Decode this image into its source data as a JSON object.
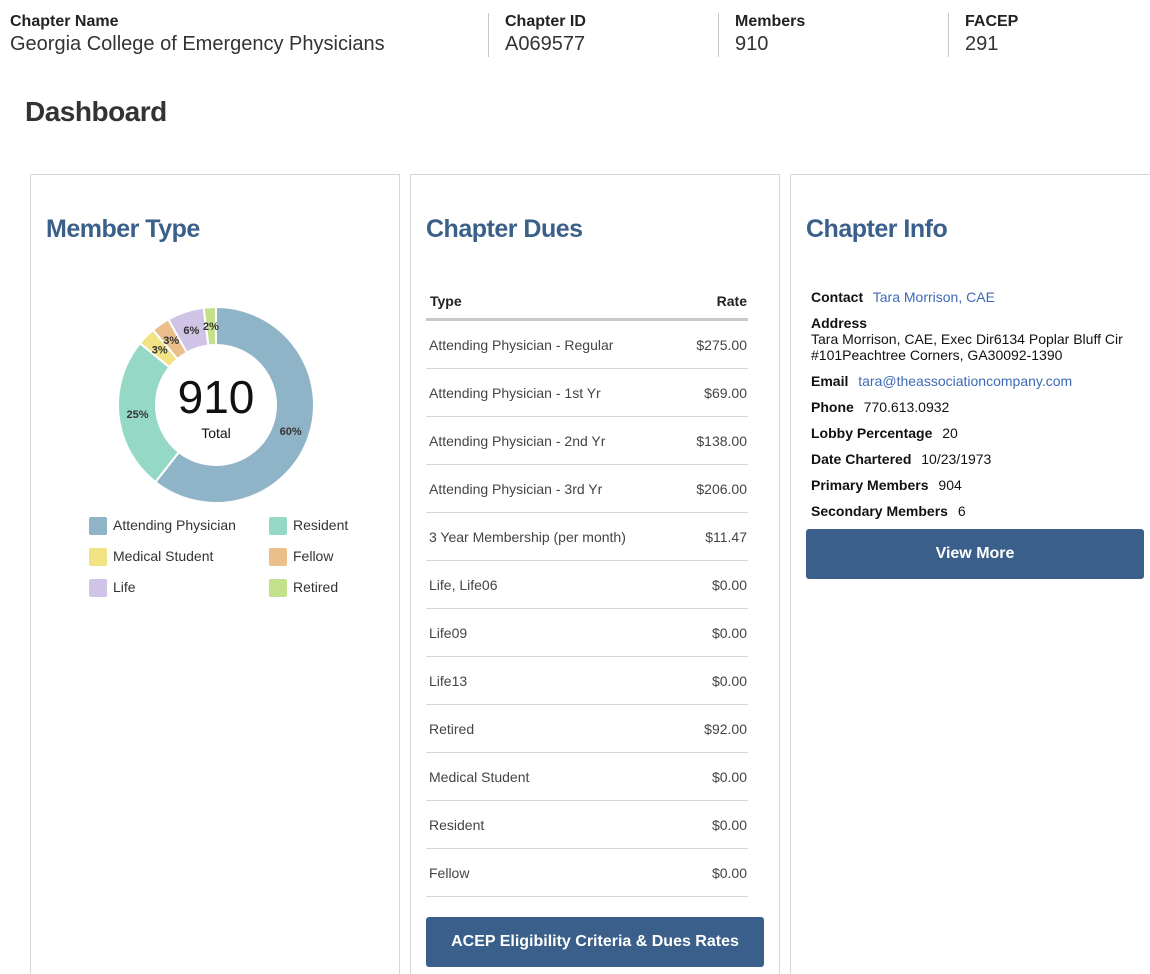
{
  "header": {
    "chapter_name_label": "Chapter Name",
    "chapter_name": "Georgia College of Emergency Physicians",
    "chapter_id_label": "Chapter ID",
    "chapter_id": "A069577",
    "members_label": "Members",
    "members": "910",
    "facep_label": "FACEP",
    "facep": "291"
  },
  "page_title": "Dashboard",
  "member_type": {
    "title": "Member Type",
    "total": "910",
    "total_label": "Total",
    "colors": {
      "Attending Physician": "#8fb4c8",
      "Resident": "#96d8c6",
      "Medical Student": "#f1e384",
      "Fellow": "#ebbf8c",
      "Life": "#cfc3e6",
      "Retired": "#c2e18a"
    }
  },
  "chart_data": {
    "type": "pie",
    "categories": [
      "Attending Physician",
      "Resident",
      "Medical Student",
      "Fellow",
      "Life",
      "Retired"
    ],
    "values": [
      60,
      25,
      3,
      3,
      6,
      2
    ],
    "labels": [
      "60%",
      "25%",
      "3%",
      "3%",
      "6%",
      "2%"
    ],
    "legend": "bottom"
  },
  "dues": {
    "title": "Chapter Dues",
    "col_type": "Type",
    "col_rate": "Rate",
    "rows": [
      {
        "type": "Attending Physician - Regular",
        "rate": "$275.00"
      },
      {
        "type": "Attending Physician - 1st Yr",
        "rate": "$69.00"
      },
      {
        "type": "Attending Physician - 2nd Yr",
        "rate": "$138.00"
      },
      {
        "type": "Attending Physician - 3rd Yr",
        "rate": "$206.00"
      },
      {
        "type": "3 Year Membership (per month)",
        "rate": "$11.47"
      },
      {
        "type": "Life, Life06",
        "rate": "$0.00"
      },
      {
        "type": "Life09",
        "rate": "$0.00"
      },
      {
        "type": "Life13",
        "rate": "$0.00"
      },
      {
        "type": "Retired",
        "rate": "$92.00"
      },
      {
        "type": "Medical Student",
        "rate": "$0.00"
      },
      {
        "type": "Resident",
        "rate": "$0.00"
      },
      {
        "type": "Fellow",
        "rate": "$0.00"
      }
    ],
    "button_label": "ACEP Eligibility Criteria & Dues Rates"
  },
  "info": {
    "title": "Chapter Info",
    "contact_label": "Contact",
    "contact": "Tara Morrison, CAE",
    "address_label": "Address",
    "address": "Tara Morrison, CAE, Exec Dir6134 Poplar Bluff Cir #101Peachtree Corners, GA30092-1390",
    "email_label": "Email",
    "email": "tara@theassociationcompany.com",
    "phone_label": "Phone",
    "phone": "770.613.0932",
    "lobby_label": "Lobby Percentage",
    "lobby": "20",
    "chartered_label": "Date Chartered",
    "chartered": "10/23/1973",
    "primary_label": "Primary Members",
    "primary": "904",
    "secondary_label": "Secondary Members",
    "secondary": "6",
    "button_label": "View More",
    "accent": "#3a5f8a",
    "link_color": "#3d6ab5"
  }
}
